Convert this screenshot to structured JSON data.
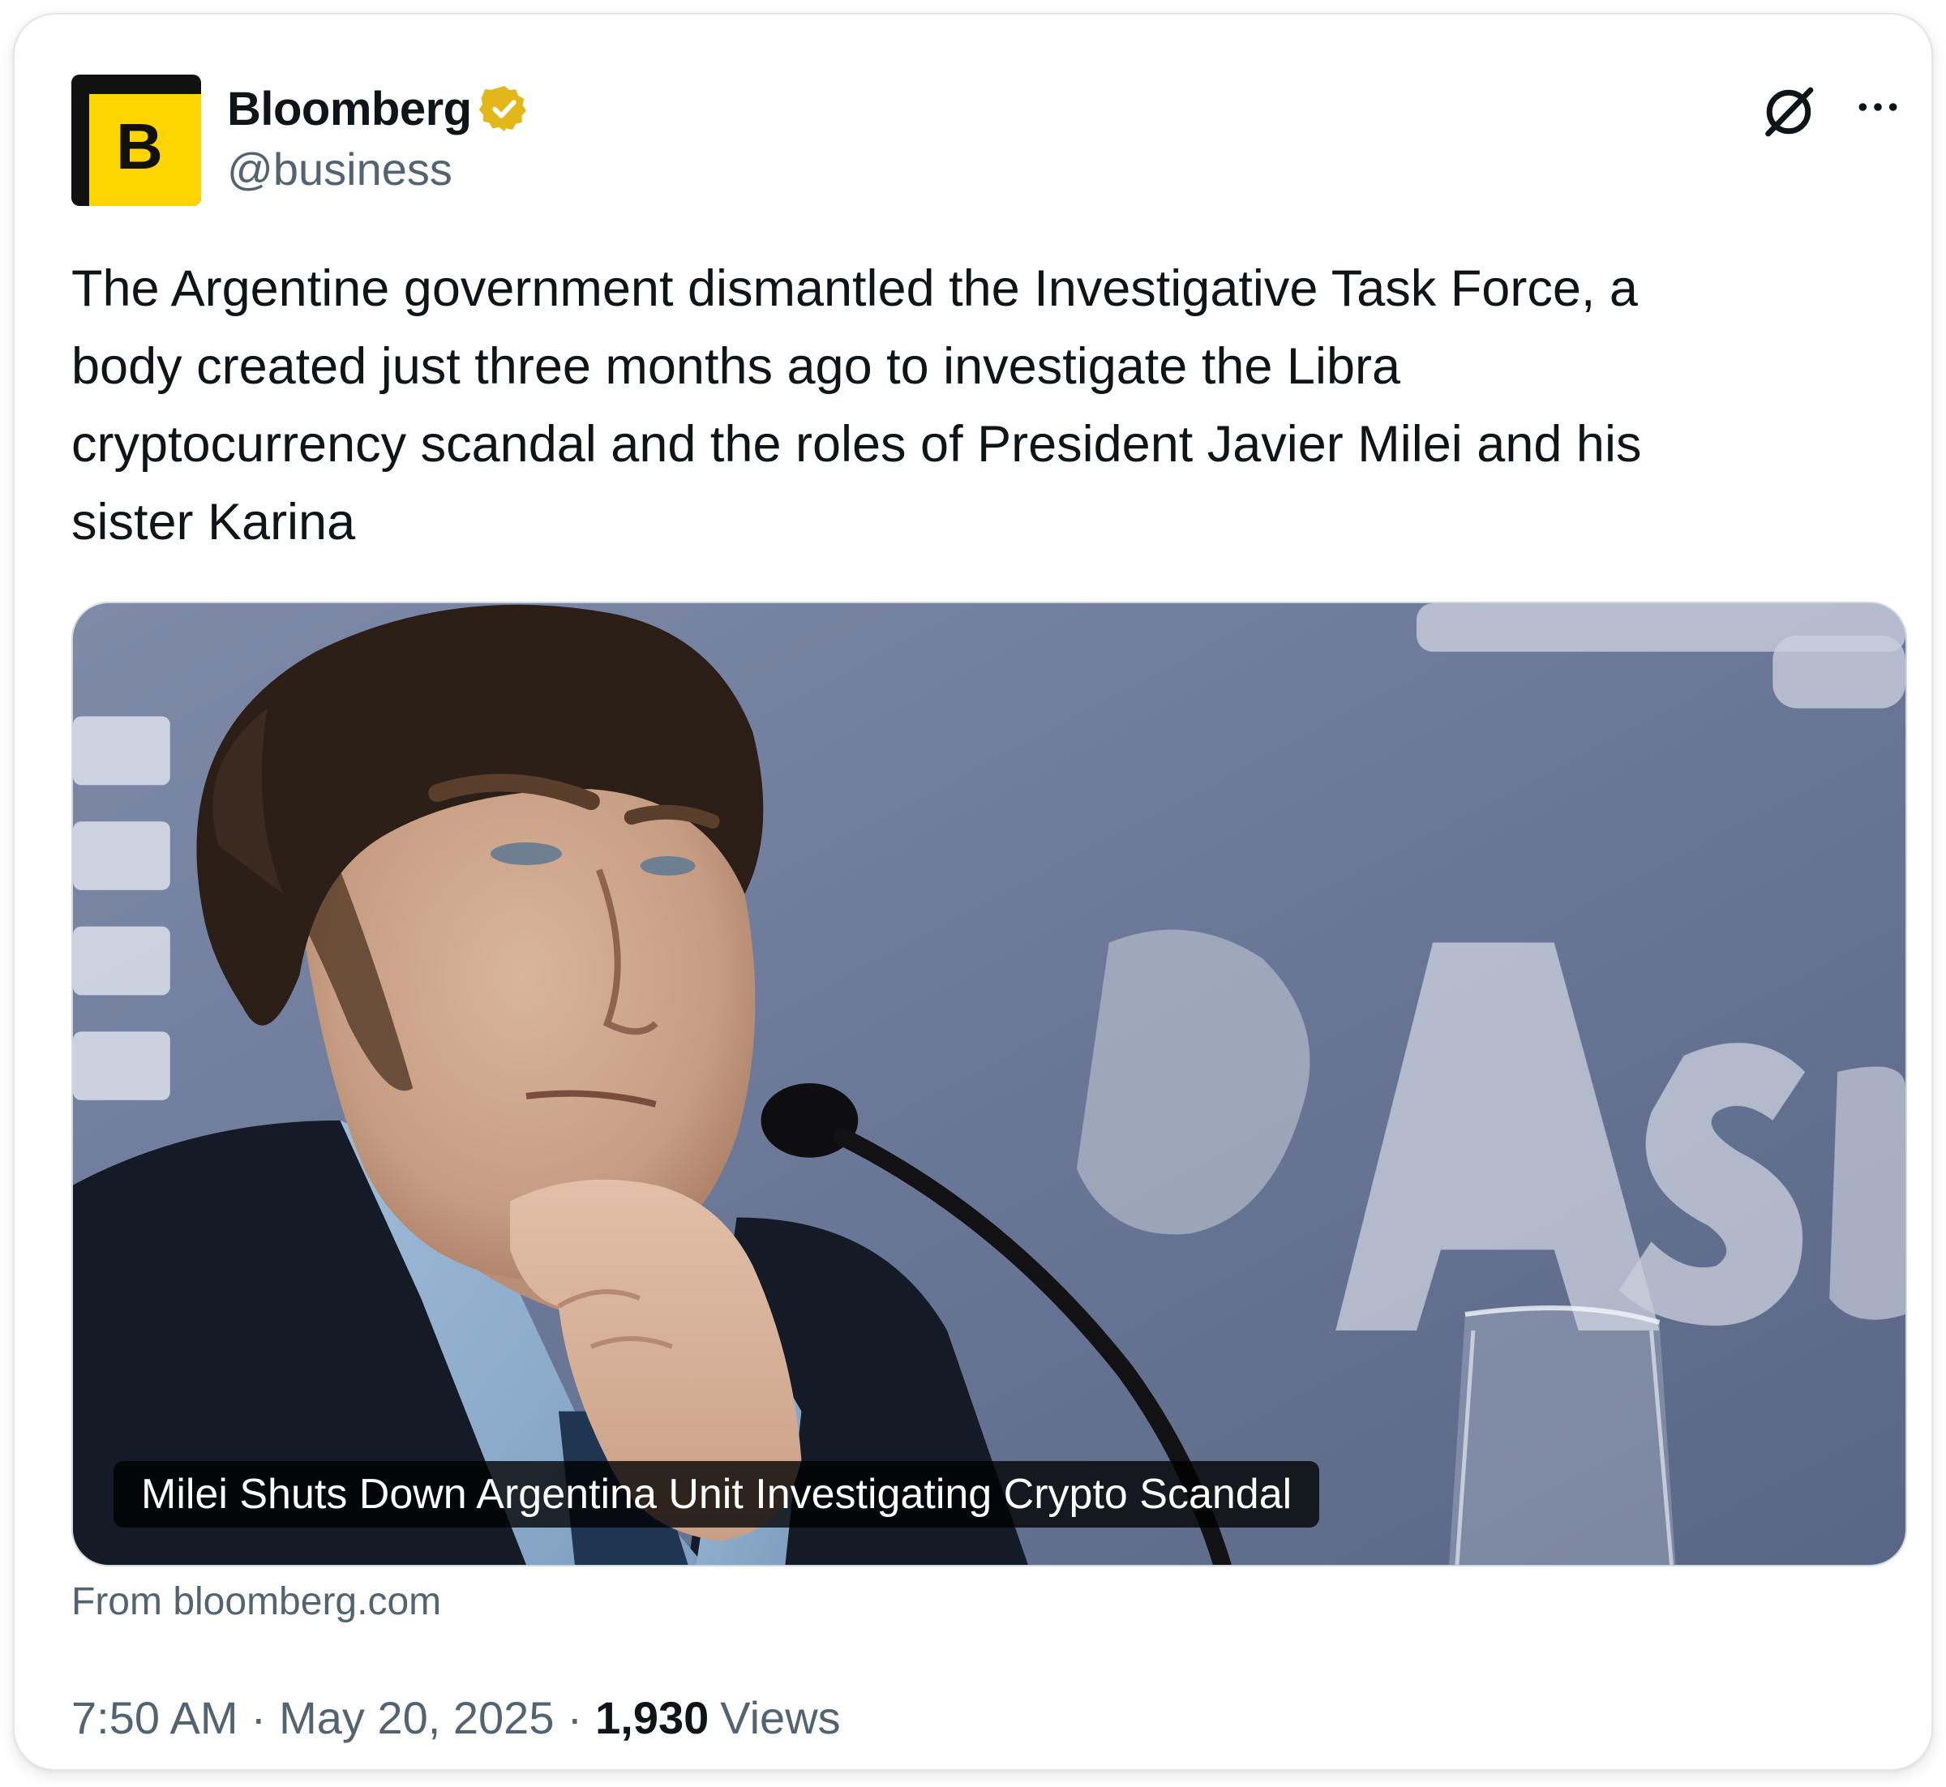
{
  "author": {
    "display_name": "Bloomberg",
    "handle": "@business",
    "avatar_letter": "B",
    "verified_icon": "verified-gold-badge-icon",
    "brand_color": "#ffd500"
  },
  "header_actions": {
    "grok_icon": "grok-icon",
    "more_icon": "more-horizontal-icon"
  },
  "tweet": {
    "text": "The Argentine government dismantled the Investigative Task Force, a\nbody created just three months ago to investigate the Libra\ncryptocurrency scandal and the roles of President Javier Milei and his\nsister Karina"
  },
  "link_card": {
    "title": "Milei Shuts Down Argentina Unit Investigating Crypto Scandal",
    "source": "From bloomberg.com"
  },
  "meta": {
    "time": "7:50 AM",
    "separator": "·",
    "date": "May 20, 2025",
    "views_count": "1,930",
    "views_label": "Views"
  },
  "colors": {
    "text_primary": "#0f1419",
    "text_secondary": "#536471",
    "verified_gold": "#e2b719"
  }
}
